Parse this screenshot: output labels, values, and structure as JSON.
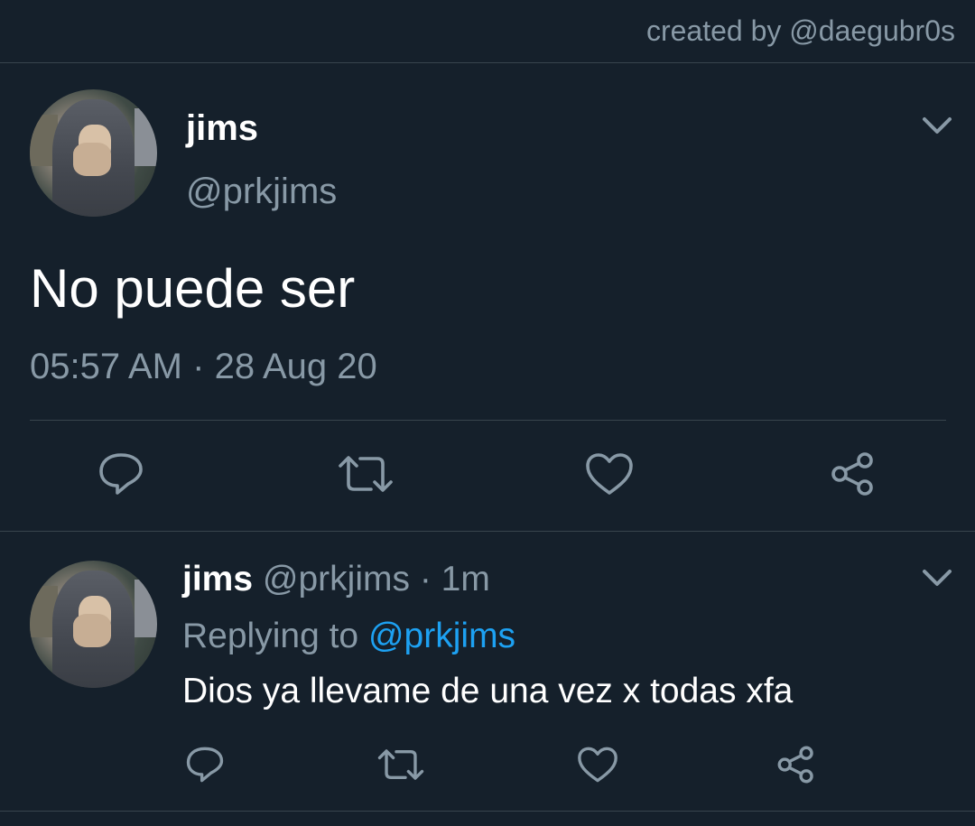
{
  "credit": "created by @daegubr0s",
  "main_tweet": {
    "display_name": "jims",
    "handle": "@prkjims",
    "text": "No puede ser",
    "time": "05:57 AM",
    "separator": "·",
    "date": "28 Aug 20",
    "icons": [
      "chevron-down-icon",
      "reply-icon",
      "retweet-icon",
      "like-icon",
      "share-icon"
    ]
  },
  "reply_tweet": {
    "display_name": "jims",
    "handle": "@prkjims",
    "separator": "·",
    "age": "1m",
    "replying_prefix": "Replying to",
    "replying_to": "@prkjims",
    "text": "Dios ya llevame de una vez x todas xfa",
    "icons": [
      "chevron-down-icon",
      "reply-icon",
      "retweet-icon",
      "like-icon",
      "share-icon"
    ]
  },
  "colors": {
    "background": "#15202b",
    "muted_text": "#8899a6",
    "accent": "#1da1f2",
    "divider": "#38444d"
  }
}
